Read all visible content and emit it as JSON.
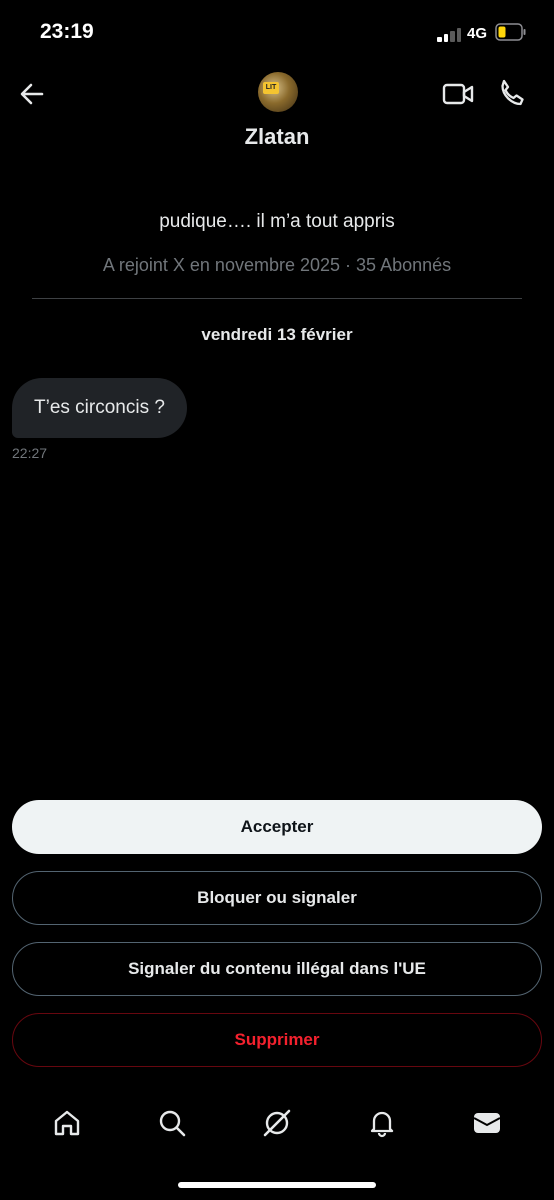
{
  "status_bar": {
    "time": "23:19",
    "network": "4G",
    "battery_color": "#ffd60a"
  },
  "header": {
    "contact_name": "Zlatan",
    "avatar_badge": "LIT"
  },
  "profile": {
    "bio": "pudique…. il m’a tout appris",
    "joined": "A rejoint X en novembre 2025",
    "separator": "·",
    "followers": "35 Abonnés"
  },
  "conversation": {
    "date_label": "vendredi 13 février",
    "messages": [
      {
        "text": "T’es circoncis ?",
        "time": "22:27"
      }
    ]
  },
  "actions": {
    "accept": "Accepter",
    "block_report": "Bloquer ou signaler",
    "report_illegal": "Signaler du contenu illégal dans l'UE",
    "delete": "Supprimer"
  },
  "nav": {
    "items": [
      "home-icon",
      "search-icon",
      "grok-icon",
      "notifications-icon",
      "messages-icon"
    ]
  },
  "colors": {
    "background": "#000000",
    "accent_delete": "#f4212e",
    "accept_bg": "#eff3f4"
  }
}
